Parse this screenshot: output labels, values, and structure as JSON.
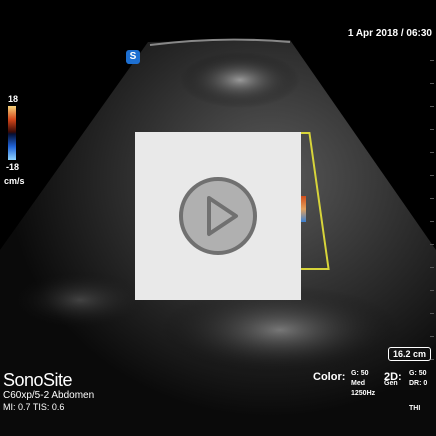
{
  "timestamp": "1 Apr 2018 / 06:30",
  "logo_glyph": "S",
  "color_scale": {
    "max": "18",
    "min": "-18",
    "unit": "cm/s"
  },
  "depth": "16.2 cm",
  "brand": "SonoSite",
  "probe": "C60xp/5-2  Abdomen",
  "indices": "MI: 0.7  TIS: 0.6",
  "color_settings": {
    "label": "Color:",
    "gain": "G: 50",
    "quality": "Med",
    "prf": "1250Hz"
  },
  "mode_2d": {
    "label": "2D:",
    "gain": "G: 50",
    "gen": "Gen",
    "dr": "DR: 0",
    "thi": "THI"
  },
  "icons": {
    "play": "play-icon",
    "logo": "sonosite-logo-icon"
  },
  "colors": {
    "background": "#000000",
    "roi": "#d7d43a",
    "overlay": "#e9e9e9"
  }
}
